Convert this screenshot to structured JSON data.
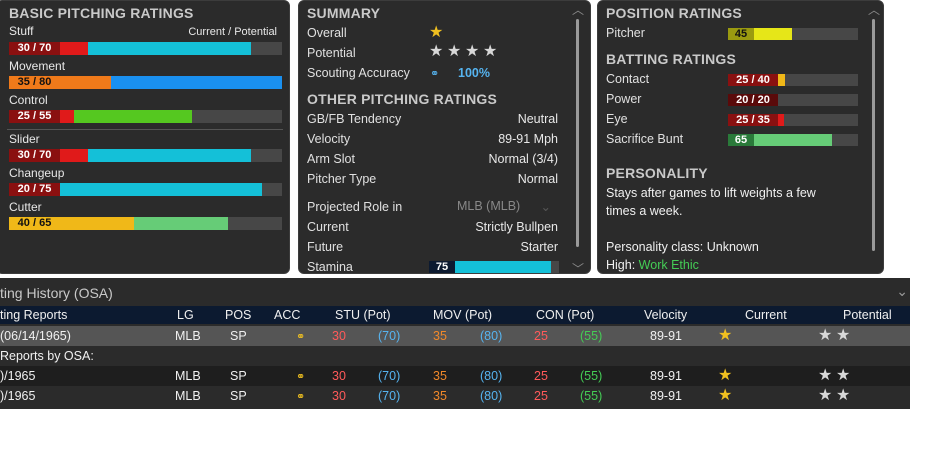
{
  "pitching": {
    "title": "BASIC PITCHING RATINGS",
    "current_potential": "Current / Potential",
    "rows": [
      {
        "label": "Stuff",
        "value": "30 / 70"
      },
      {
        "label": "Movement",
        "value": "35 / 80"
      },
      {
        "label": "Control",
        "value": "25 / 55"
      },
      {
        "label": "Slider",
        "value": "30 / 70"
      },
      {
        "label": "Changeup",
        "value": "20 / 75"
      },
      {
        "label": "Cutter",
        "value": "40 / 65"
      }
    ],
    "colors": {
      "box_red": "#8a1010",
      "cyan": "#14c0d8",
      "orange": "#f07a1a",
      "blue": "#1a90f0",
      "green": "#55c820",
      "yellow": "#f0b818",
      "light_green": "#66cc77",
      "red_seg": "#e01a1a"
    }
  },
  "summary": {
    "title": "SUMMARY",
    "overall_label": "Overall",
    "potential_label": "Potential",
    "scouting_label": "Scouting Accuracy",
    "scouting_value": "100%",
    "overall_stars": 0.5,
    "potential_stars": 4
  },
  "other_pitching": {
    "title": "OTHER PITCHING RATINGS",
    "rows": [
      {
        "label": "GB/FB Tendency",
        "value": "Neutral"
      },
      {
        "label": "Velocity",
        "value": "89-91 Mph"
      },
      {
        "label": "Arm Slot",
        "value": "Normal (3/4)"
      },
      {
        "label": "Pitcher Type",
        "value": "Normal"
      }
    ],
    "projected_label": "Projected Role in",
    "projected_select": "MLB (MLB)",
    "current_label": "Current",
    "current_value": "Strictly Bullpen",
    "future_label": "Future",
    "future_value": "Starter",
    "stamina_label": "Stamina",
    "stamina_value": "75"
  },
  "position": {
    "title": "POSITION RATINGS",
    "pitcher_label": "Pitcher",
    "pitcher_value": "45"
  },
  "batting": {
    "title": "BATTING RATINGS",
    "rows": [
      {
        "label": "Contact",
        "value": "25 / 40"
      },
      {
        "label": "Power",
        "value": "20 / 20"
      },
      {
        "label": "Eye",
        "value": "25 / 35"
      },
      {
        "label": "Sacrifice Bunt",
        "value": "65"
      }
    ]
  },
  "personality": {
    "title": "PERSONALITY",
    "description_line1": "Stays after games to lift weights a few",
    "description_line2": "times a week.",
    "class_line": "Personality class: Unknown",
    "high_label": "High:",
    "high_value": "Work Ethic"
  },
  "history": {
    "title": "ting History (OSA)",
    "columns": [
      "ting Reports",
      "LG",
      "POS",
      "ACC",
      "STU (Pot)",
      "MOV (Pot)",
      "CON (Pot)",
      "Velocity",
      "Current",
      "Potential"
    ],
    "rows": [
      {
        "date": "(06/14/1965)",
        "lg": "MLB",
        "pos": "SP",
        "stu": "30",
        "stu_pot": "(70)",
        "mov": "35",
        "mov_pot": "(80)",
        "con": "25",
        "con_pot": "(55)",
        "velo": "89-91"
      },
      {
        "date": "Reports by OSA:"
      },
      {
        "date": ")/1965",
        "lg": "MLB",
        "pos": "SP",
        "stu": "30",
        "stu_pot": "(70)",
        "mov": "35",
        "mov_pot": "(80)",
        "con": "25",
        "con_pot": "(55)",
        "velo": "89-91"
      },
      {
        "date": ")/1965",
        "lg": "MLB",
        "pos": "SP",
        "stu": "30",
        "stu_pot": "(70)",
        "mov": "35",
        "mov_pot": "(80)",
        "con": "25",
        "con_pot": "(55)",
        "velo": "89-91"
      }
    ]
  }
}
